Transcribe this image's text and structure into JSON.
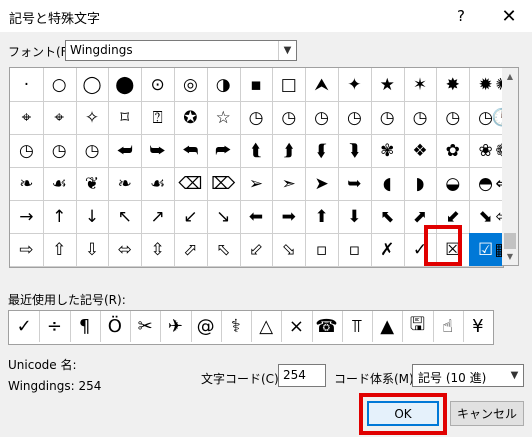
{
  "title": "記号と特殊文字",
  "titlebar": {
    "help_label": "?",
    "close_label": "✕"
  },
  "font": {
    "label": "フォント(F):",
    "value": "Wingdings"
  },
  "grid": {
    "rows": [
      [
        "·",
        "○",
        "◯",
        "⬤",
        "⊙",
        "◎",
        "◑",
        "▪",
        "□",
        "⮝",
        "✦",
        "★",
        "✶",
        "✸",
        "✹"
      ],
      [
        "⌖",
        "⌖",
        "✧",
        "⌑",
        "⍰",
        "✪",
        "☆",
        "◷",
        "◷",
        "◷",
        "◷",
        "◷",
        "◷",
        "◷",
        "◷"
      ],
      [
        "◷",
        "◷",
        "◷",
        "⮨",
        "⮩",
        "⮪",
        "⮫",
        "⮬",
        "⮭",
        "⮮",
        "⮯",
        "✾",
        "❖",
        "✿",
        "❀"
      ],
      [
        "❧",
        "☙",
        "❦",
        "❧",
        "☙",
        "⌫",
        "⌦",
        "➢",
        "➣",
        "➤",
        "➥",
        "◖",
        "◗",
        "◒",
        "◓"
      ],
      [
        "→",
        "↑",
        "↓",
        "↖",
        "↗",
        "↙",
        "↘",
        "⬅",
        "➡",
        "⬆",
        "⬇",
        "⬉",
        "⬈",
        "⬋",
        "⬊"
      ],
      [
        "⇨",
        "⇧",
        "⇩",
        "⬄",
        "⇳",
        "⬀",
        "⬁",
        "⬃",
        "⬂",
        "▫",
        "▫",
        "✗",
        "✓",
        "☒",
        "☑"
      ]
    ],
    "extra_col": [
      "✺",
      "🕛",
      "❁",
      "⇐",
      "⇦",
      "▦"
    ]
  },
  "recent": {
    "label": "最近使用した記号(R):",
    "items": [
      "✓",
      "÷",
      "¶",
      "Ö",
      "✂",
      "✈",
      "@",
      "⚕",
      "△",
      "×",
      "☎",
      "⫪",
      "▲",
      "🖫",
      "☝",
      "¥"
    ]
  },
  "unicode_name_label": "Unicode 名:",
  "wingdings_code": "Wingdings: 254",
  "char_code": {
    "label": "文字コード(C):",
    "value": "254"
  },
  "code_system": {
    "label": "コード体系(M):",
    "value": "記号 (10 進)"
  },
  "buttons": {
    "ok": "OK",
    "cancel": "キャンセル"
  },
  "colors": {
    "selection": "#0078d7",
    "highlight": "#e00000"
  }
}
